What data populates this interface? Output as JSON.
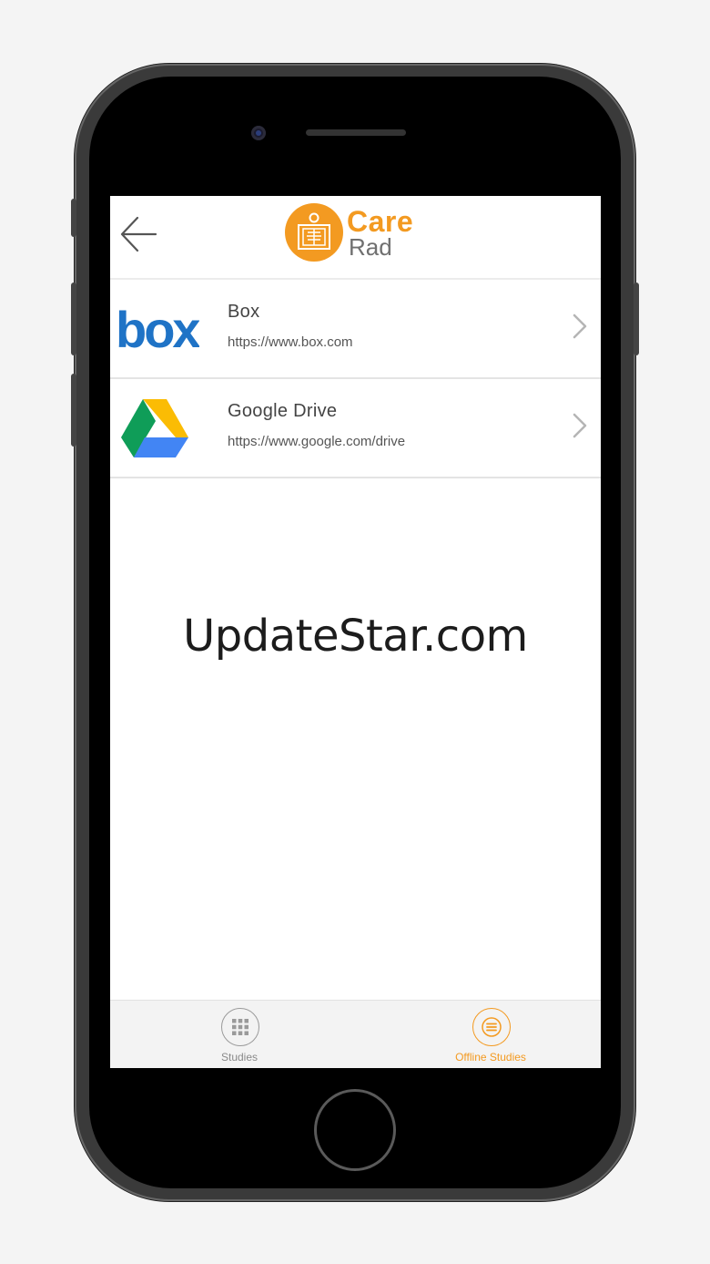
{
  "header": {
    "logo_line1": "Care",
    "logo_line2": "Rad",
    "back_icon": "arrow-left-icon"
  },
  "storage_options": [
    {
      "title": "Box",
      "url": "https://www.box.com",
      "logo_text": "box",
      "icon": "box-logo"
    },
    {
      "title": "Google Drive",
      "url": "https://www.google.com/drive",
      "icon": "google-drive-logo"
    }
  ],
  "watermark": "UpdateStar.com",
  "tabbar": {
    "tabs": [
      {
        "label": "Studies",
        "icon": "grid-icon",
        "active": false
      },
      {
        "label": "Offline Studies",
        "icon": "menu-lines-icon",
        "active": true
      }
    ]
  },
  "colors": {
    "accent": "#f39a21",
    "box_blue": "#1f73c6",
    "inactive": "#8a8a8a"
  }
}
